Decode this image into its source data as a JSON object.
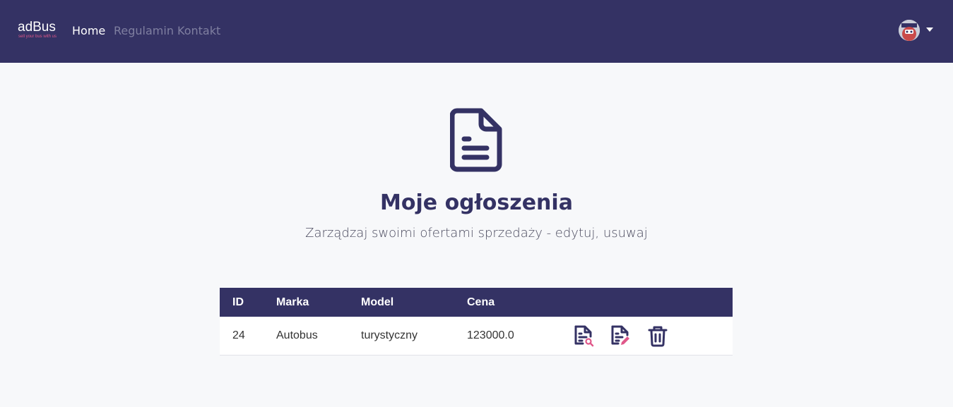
{
  "brand": {
    "name": "adBus",
    "tagline": "sell your bus with us"
  },
  "nav": {
    "home": "Home",
    "regulamin": "Regulamin",
    "kontakt": "Kontakt"
  },
  "page": {
    "title": "Moje ogłoszenia",
    "subtitle": "Zarządzaj swoimi ofertami sprzedaży - edytuj, usuwaj"
  },
  "table": {
    "headers": {
      "id": "ID",
      "marka": "Marka",
      "model": "Model",
      "cena": "Cena"
    },
    "rows": [
      {
        "id": "24",
        "marka": "Autobus",
        "model": "turystyczny",
        "cena": "123000.0"
      }
    ]
  },
  "icons": {
    "hero": "document-icon",
    "view": "document-search-icon",
    "edit": "document-edit-icon",
    "delete": "trash-icon"
  },
  "colors": {
    "navbar": "#343264",
    "accent": "#e0588a",
    "background": "#f7f8fa"
  }
}
